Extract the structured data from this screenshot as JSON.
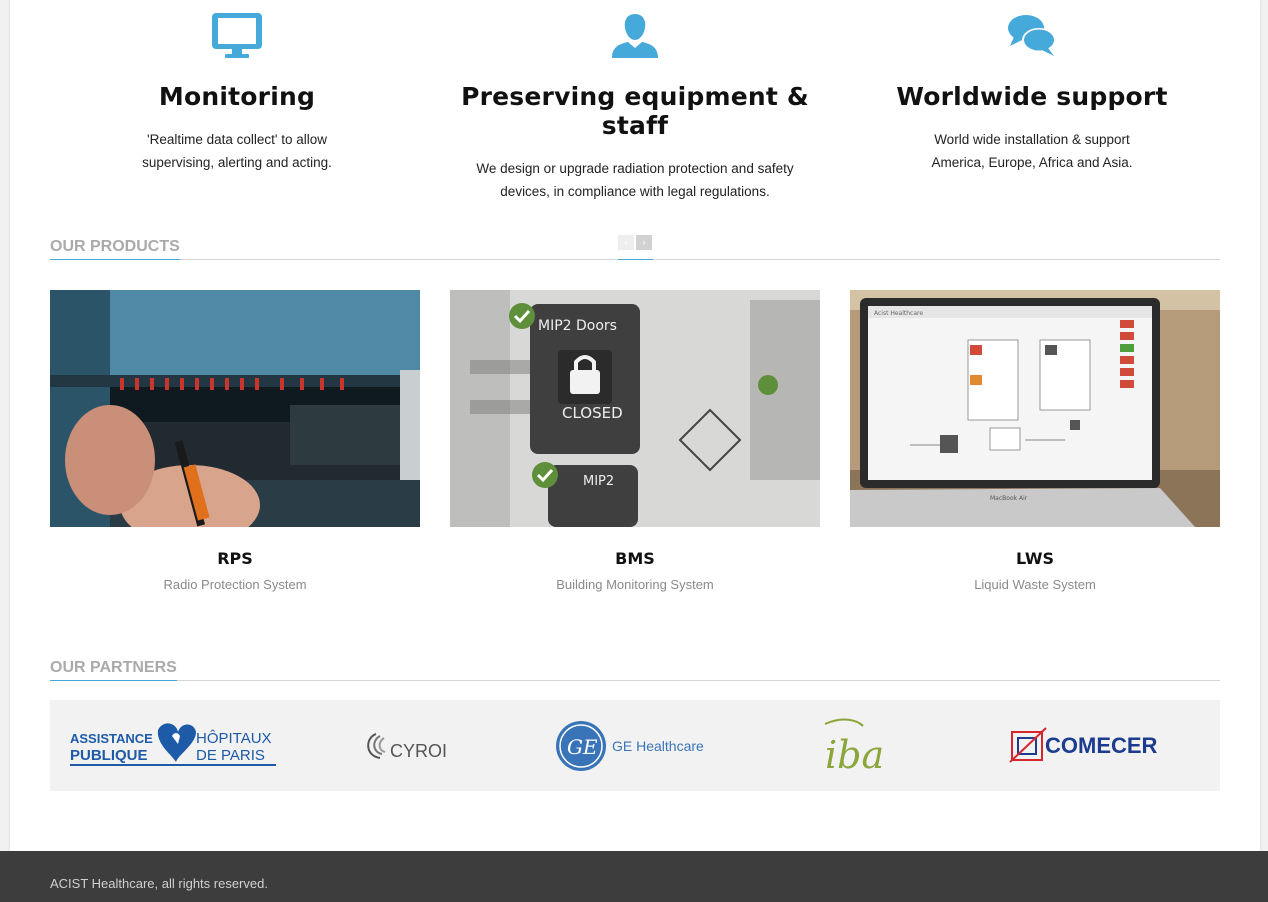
{
  "features": [
    {
      "icon": "monitor-icon",
      "title": "Monitoring",
      "line1": "'Realtime data collect' to allow",
      "line2": "supervising, alerting and acting."
    },
    {
      "icon": "user-icon",
      "title": "Preserving equipment & staff",
      "line1": "We design or upgrade radiation protection and safety",
      "line2": "devices, in compliance with legal regulations."
    },
    {
      "icon": "chat-bubbles-icon",
      "title": "Worldwide support",
      "line1": "World wide installation & support",
      "line2": "America, Europe, Africa and Asia."
    }
  ],
  "products_section": {
    "title": "Our products",
    "prev": "‹",
    "next": "›"
  },
  "products": [
    {
      "code": "RPS",
      "name": "Radio Protection System"
    },
    {
      "code": "BMS",
      "name": "Building Monitoring System"
    },
    {
      "code": "LWS",
      "name": "Liquid Waste System"
    }
  ],
  "product_images": {
    "bms_label1": "MIP2 Doors",
    "bms_label2": "CLOSED",
    "bms_label3": "MIP2",
    "lws_screen_title": "Acist Healthcare",
    "lws_laptop_brand": "MacBook Air"
  },
  "partners_section": {
    "title": "Our partners"
  },
  "partners": {
    "aphp_line1": "ASSISTANCE",
    "aphp_line2": "PUBLIQUE",
    "aphp_line3": "HÔPITAUX",
    "aphp_line4": "DE PARIS",
    "cyroi": "CYROI",
    "ge_mark": "GE",
    "ge": "GE Healthcare",
    "iba": "iba",
    "comecer": "COMECER"
  },
  "colors": {
    "accent": "#45a9d9",
    "icon": "#45a9d9",
    "footer": "#3d3d3d"
  },
  "footer": {
    "copyright": "ACIST Healthcare, all rights reserved."
  }
}
